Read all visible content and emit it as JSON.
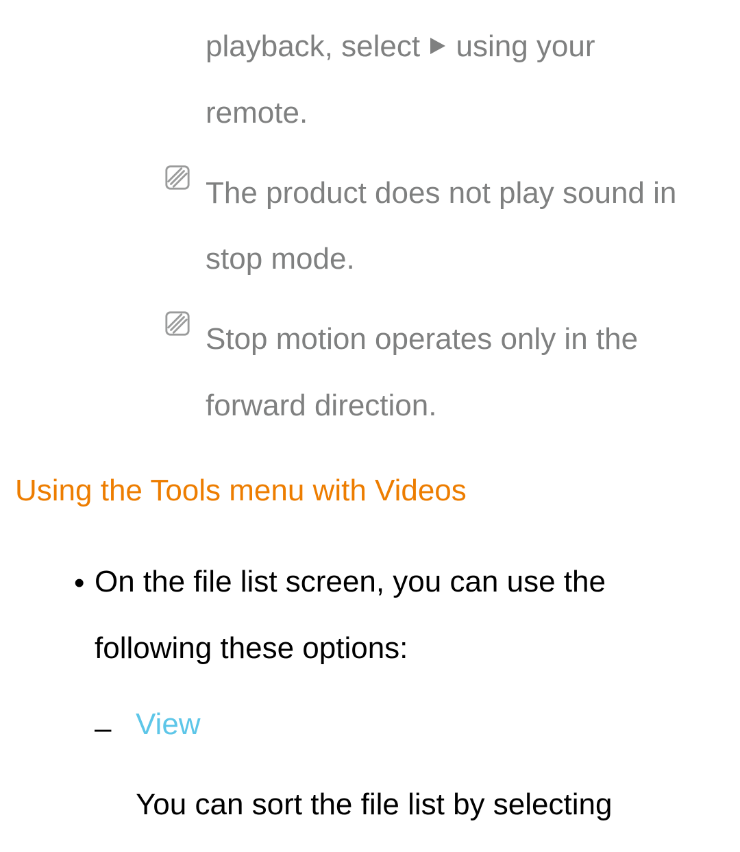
{
  "notes": {
    "continuation_pre": "playback, select ",
    "continuation_post": " using your remote.",
    "item2": "The product does not play sound in stop mode.",
    "item3": "Stop motion operates only in the forward direction."
  },
  "section": {
    "heading": "Using the Tools menu with Videos"
  },
  "bullet": {
    "text": "On the file list screen, you can use the following these options:"
  },
  "dash": {
    "label": "View",
    "body": "You can sort the file list by selecting"
  }
}
